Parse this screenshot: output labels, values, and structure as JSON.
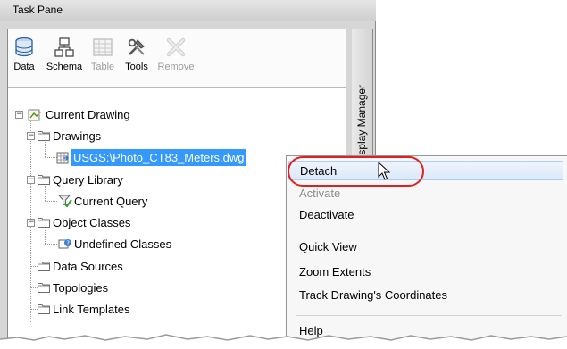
{
  "pane": {
    "title": "Task Pane",
    "side_tab": "Display Manager"
  },
  "toolbar": {
    "buttons": [
      {
        "label": "Data",
        "icon": "database-icon",
        "enabled": true
      },
      {
        "label": "Schema",
        "icon": "schema-icon",
        "enabled": true
      },
      {
        "label": "Table",
        "icon": "table-icon",
        "enabled": false
      },
      {
        "label": "Tools",
        "icon": "tools-icon",
        "enabled": true
      },
      {
        "label": "Remove",
        "icon": "remove-icon",
        "enabled": false
      }
    ]
  },
  "tree": {
    "root": "Current Drawing",
    "drawings": "Drawings",
    "attached_drawing": "USGS:\\Photo_CT83_Meters.dwg",
    "query_library": "Query Library",
    "current_query": "Current Query",
    "object_classes": "Object Classes",
    "undefined_classes": "Undefined Classes",
    "data_sources": "Data Sources",
    "topologies": "Topologies",
    "link_templates": "Link Templates"
  },
  "context_menu": {
    "items": [
      {
        "label": "Detach",
        "enabled": true,
        "highlighted": true
      },
      {
        "label": "Activate",
        "enabled": false
      },
      {
        "label": "Deactivate",
        "enabled": true
      },
      {
        "label": "Quick View",
        "enabled": true
      },
      {
        "label": "Zoom Extents",
        "enabled": true
      },
      {
        "label": "Track Drawing's Coordinates",
        "enabled": true
      },
      {
        "label": "Help",
        "enabled": true
      }
    ]
  },
  "colors": {
    "selection": "#3399ff",
    "highlight_ring": "#e02020",
    "menu_hover": "#dce9fa"
  }
}
